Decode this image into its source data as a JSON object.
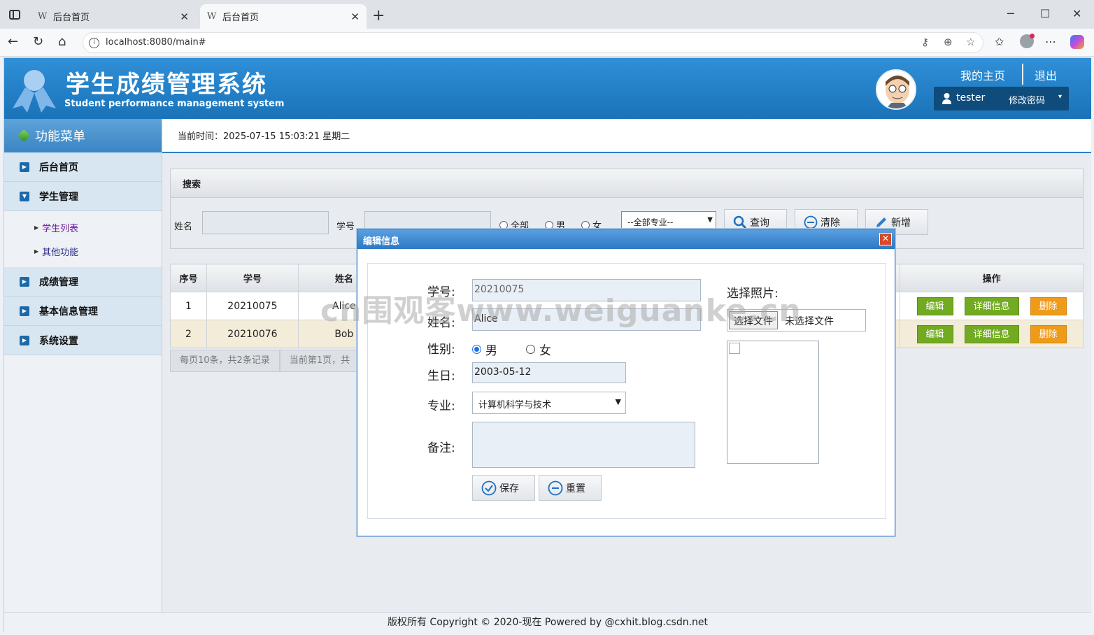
{
  "browser": {
    "tabs": [
      {
        "icon": "W",
        "title": "后台首页"
      },
      {
        "icon": "W",
        "title": "后台首页"
      }
    ],
    "url": "localhost:8080/main#",
    "win": {
      "minimize": "─",
      "maximize": "☐",
      "close": "✕"
    }
  },
  "header": {
    "title": "学生成绩管理系统",
    "subtitle": "Student performance management system",
    "home_link": "我的主页",
    "logout_link": "退出",
    "username": "tester",
    "change_password": "修改密码",
    "caret": "▾"
  },
  "sidebar": {
    "heading": "功能菜单",
    "items": [
      {
        "label": "后台首页"
      },
      {
        "label": "学生管理"
      },
      {
        "label": "成绩管理"
      },
      {
        "label": "基本信息管理"
      },
      {
        "label": "系统设置"
      }
    ],
    "subitems": [
      {
        "label": "学生列表"
      },
      {
        "label": "其他功能"
      }
    ]
  },
  "main": {
    "time_label": "当前时间：",
    "time_value": "2025-07-15 15:03:21 星期二",
    "search": {
      "heading": "搜索",
      "name_label": "姓名",
      "sid_label": "学号",
      "radio_all": "全部",
      "radio_male": "男",
      "radio_female": "女",
      "major_select": "--全部专业--",
      "query_btn": "查询",
      "clear_btn": "清除",
      "add_btn": "新增"
    },
    "table": {
      "columns": [
        "序号",
        "学号",
        "姓名",
        "操作"
      ],
      "rows": [
        {
          "no": "1",
          "sid": "20210075",
          "name": "Alice"
        },
        {
          "no": "2",
          "sid": "20210076",
          "name": "Bob"
        }
      ],
      "edit": "编辑",
      "detail": "详细信息",
      "delete": "删除"
    },
    "pager": {
      "info1": "每页10条，共2条记录",
      "info2": "当前第1页，共"
    }
  },
  "dialog": {
    "title": "编辑信息",
    "close": "✕",
    "sid_label": "学号:",
    "sid_value": "20210075",
    "name_label": "姓名:",
    "name_value": "Alice",
    "gender_label": "性别:",
    "gender_male": "男",
    "gender_female": "女",
    "birthday_label": "生日:",
    "birthday_value": "2003-05-12",
    "major_label": "专业:",
    "major_value": "计算机科学与技术",
    "note_label": "备注:",
    "photo_label": "选择照片:",
    "file_button": "选择文件",
    "file_status": "未选择文件",
    "save_btn": "保存",
    "reset_btn": "重置",
    "selected_gender": "男"
  },
  "footer": "版权所有 Copyright © 2020-现在 Powered by @cxhit.blog.csdn.net",
  "watermark": "cn围观客www.weiguanke.cn",
  "colors": {
    "accent": "#2c7fc4",
    "header": "#1a73b8",
    "green": "#72ab21",
    "orange": "#ef9b1a"
  }
}
